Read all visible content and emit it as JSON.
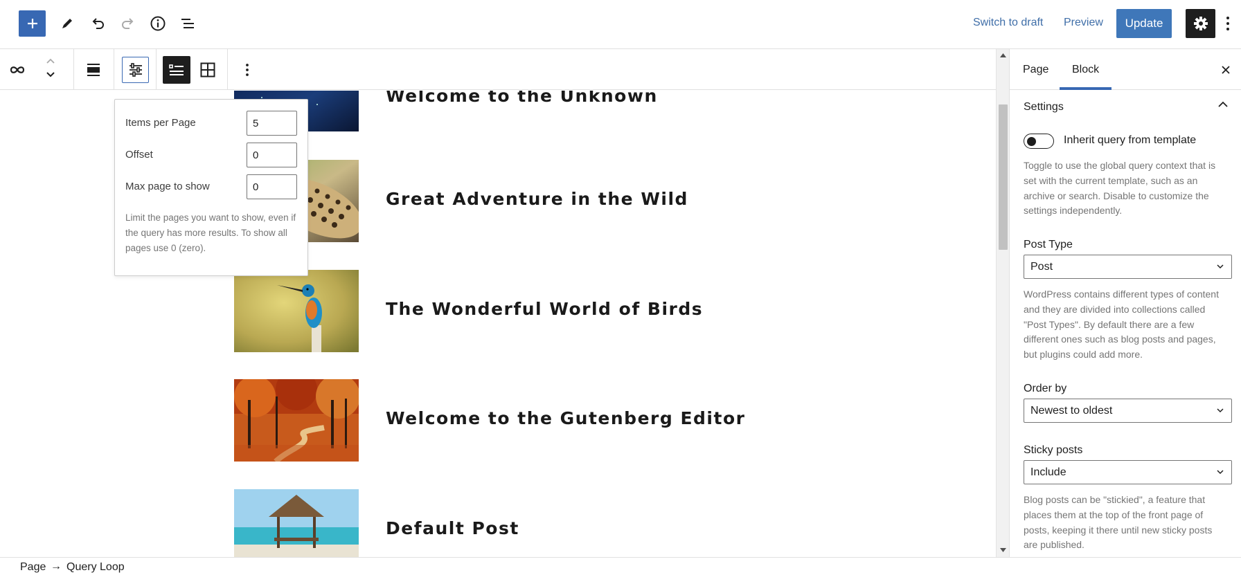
{
  "topbar": {
    "switch_to_draft": "Switch to draft",
    "preview": "Preview",
    "update": "Update"
  },
  "posts": [
    {
      "title": "Welcome to the Unknown",
      "thumb": "night-sky"
    },
    {
      "title": "Great Adventure in the Wild",
      "thumb": "leopard"
    },
    {
      "title": "The Wonderful World of Birds",
      "thumb": "kingfisher"
    },
    {
      "title": "Welcome to the Gutenberg Editor",
      "thumb": "autumn-forest"
    },
    {
      "title": "Default Post",
      "thumb": "beach-hut"
    }
  ],
  "popover": {
    "items_per_page_label": "Items per Page",
    "items_per_page_value": "5",
    "offset_label": "Offset",
    "offset_value": "0",
    "max_page_label": "Max page to show",
    "max_page_value": "0",
    "help": "Limit the pages you want to show, even if the query has more results. To show all pages use 0 (zero)."
  },
  "sidebar": {
    "tabs": [
      "Page",
      "Block"
    ],
    "active_tab": "Block",
    "section_title": "Settings",
    "inherit_label": "Inherit query from template",
    "inherit_help": "Toggle to use the global query context that is set with the current template, such as an archive or search. Disable to customize the settings independently.",
    "post_type_label": "Post Type",
    "post_type_value": "Post",
    "post_type_help": "WordPress contains different types of content and they are divided into collections called \"Post Types\". By default there are a few different ones such as blog posts and pages, but plugins could add more.",
    "order_by_label": "Order by",
    "order_by_value": "Newest to oldest",
    "sticky_label": "Sticky posts",
    "sticky_value": "Include",
    "sticky_help": "Blog posts can be \"stickied\", a feature that places them at the top of the front page of posts, keeping it there until new sticky posts are published."
  },
  "breadcrumb": {
    "root": "Page",
    "arrow": "→",
    "current": "Query Loop"
  },
  "colors": {
    "accent": "#3868b3",
    "link": "#3f6ea8",
    "dark": "#1e1e1e",
    "help_text": "#757575"
  }
}
